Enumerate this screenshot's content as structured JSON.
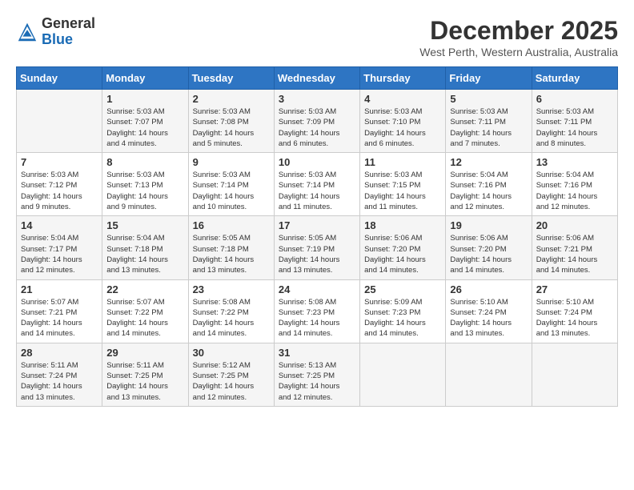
{
  "header": {
    "logo_line1": "General",
    "logo_line2": "Blue",
    "month": "December 2025",
    "location": "West Perth, Western Australia, Australia"
  },
  "weekdays": [
    "Sunday",
    "Monday",
    "Tuesday",
    "Wednesday",
    "Thursday",
    "Friday",
    "Saturday"
  ],
  "weeks": [
    [
      {
        "day": "",
        "info": ""
      },
      {
        "day": "1",
        "info": "Sunrise: 5:03 AM\nSunset: 7:07 PM\nDaylight: 14 hours\nand 4 minutes."
      },
      {
        "day": "2",
        "info": "Sunrise: 5:03 AM\nSunset: 7:08 PM\nDaylight: 14 hours\nand 5 minutes."
      },
      {
        "day": "3",
        "info": "Sunrise: 5:03 AM\nSunset: 7:09 PM\nDaylight: 14 hours\nand 6 minutes."
      },
      {
        "day": "4",
        "info": "Sunrise: 5:03 AM\nSunset: 7:10 PM\nDaylight: 14 hours\nand 6 minutes."
      },
      {
        "day": "5",
        "info": "Sunrise: 5:03 AM\nSunset: 7:11 PM\nDaylight: 14 hours\nand 7 minutes."
      },
      {
        "day": "6",
        "info": "Sunrise: 5:03 AM\nSunset: 7:11 PM\nDaylight: 14 hours\nand 8 minutes."
      }
    ],
    [
      {
        "day": "7",
        "info": "Sunrise: 5:03 AM\nSunset: 7:12 PM\nDaylight: 14 hours\nand 9 minutes."
      },
      {
        "day": "8",
        "info": "Sunrise: 5:03 AM\nSunset: 7:13 PM\nDaylight: 14 hours\nand 9 minutes."
      },
      {
        "day": "9",
        "info": "Sunrise: 5:03 AM\nSunset: 7:14 PM\nDaylight: 14 hours\nand 10 minutes."
      },
      {
        "day": "10",
        "info": "Sunrise: 5:03 AM\nSunset: 7:14 PM\nDaylight: 14 hours\nand 11 minutes."
      },
      {
        "day": "11",
        "info": "Sunrise: 5:03 AM\nSunset: 7:15 PM\nDaylight: 14 hours\nand 11 minutes."
      },
      {
        "day": "12",
        "info": "Sunrise: 5:04 AM\nSunset: 7:16 PM\nDaylight: 14 hours\nand 12 minutes."
      },
      {
        "day": "13",
        "info": "Sunrise: 5:04 AM\nSunset: 7:16 PM\nDaylight: 14 hours\nand 12 minutes."
      }
    ],
    [
      {
        "day": "14",
        "info": "Sunrise: 5:04 AM\nSunset: 7:17 PM\nDaylight: 14 hours\nand 12 minutes."
      },
      {
        "day": "15",
        "info": "Sunrise: 5:04 AM\nSunset: 7:18 PM\nDaylight: 14 hours\nand 13 minutes."
      },
      {
        "day": "16",
        "info": "Sunrise: 5:05 AM\nSunset: 7:18 PM\nDaylight: 14 hours\nand 13 minutes."
      },
      {
        "day": "17",
        "info": "Sunrise: 5:05 AM\nSunset: 7:19 PM\nDaylight: 14 hours\nand 13 minutes."
      },
      {
        "day": "18",
        "info": "Sunrise: 5:06 AM\nSunset: 7:20 PM\nDaylight: 14 hours\nand 14 minutes."
      },
      {
        "day": "19",
        "info": "Sunrise: 5:06 AM\nSunset: 7:20 PM\nDaylight: 14 hours\nand 14 minutes."
      },
      {
        "day": "20",
        "info": "Sunrise: 5:06 AM\nSunset: 7:21 PM\nDaylight: 14 hours\nand 14 minutes."
      }
    ],
    [
      {
        "day": "21",
        "info": "Sunrise: 5:07 AM\nSunset: 7:21 PM\nDaylight: 14 hours\nand 14 minutes."
      },
      {
        "day": "22",
        "info": "Sunrise: 5:07 AM\nSunset: 7:22 PM\nDaylight: 14 hours\nand 14 minutes."
      },
      {
        "day": "23",
        "info": "Sunrise: 5:08 AM\nSunset: 7:22 PM\nDaylight: 14 hours\nand 14 minutes."
      },
      {
        "day": "24",
        "info": "Sunrise: 5:08 AM\nSunset: 7:23 PM\nDaylight: 14 hours\nand 14 minutes."
      },
      {
        "day": "25",
        "info": "Sunrise: 5:09 AM\nSunset: 7:23 PM\nDaylight: 14 hours\nand 14 minutes."
      },
      {
        "day": "26",
        "info": "Sunrise: 5:10 AM\nSunset: 7:24 PM\nDaylight: 14 hours\nand 13 minutes."
      },
      {
        "day": "27",
        "info": "Sunrise: 5:10 AM\nSunset: 7:24 PM\nDaylight: 14 hours\nand 13 minutes."
      }
    ],
    [
      {
        "day": "28",
        "info": "Sunrise: 5:11 AM\nSunset: 7:24 PM\nDaylight: 14 hours\nand 13 minutes."
      },
      {
        "day": "29",
        "info": "Sunrise: 5:11 AM\nSunset: 7:25 PM\nDaylight: 14 hours\nand 13 minutes."
      },
      {
        "day": "30",
        "info": "Sunrise: 5:12 AM\nSunset: 7:25 PM\nDaylight: 14 hours\nand 12 minutes."
      },
      {
        "day": "31",
        "info": "Sunrise: 5:13 AM\nSunset: 7:25 PM\nDaylight: 14 hours\nand 12 minutes."
      },
      {
        "day": "",
        "info": ""
      },
      {
        "day": "",
        "info": ""
      },
      {
        "day": "",
        "info": ""
      }
    ]
  ]
}
